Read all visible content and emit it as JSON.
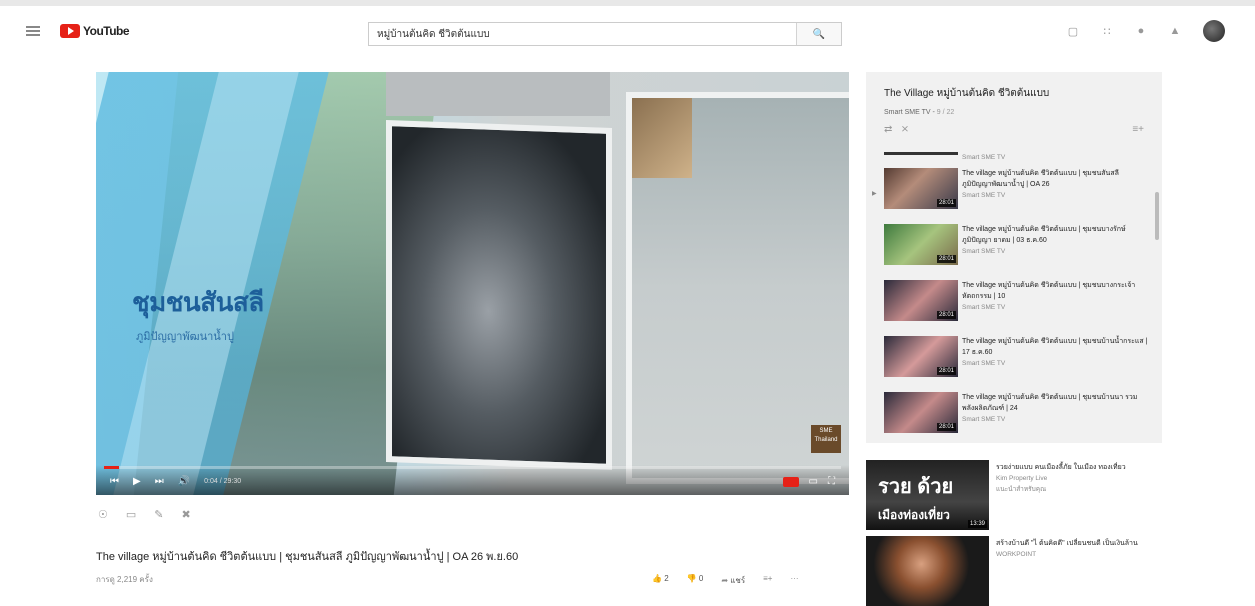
{
  "header": {
    "logo_text": "YouTube",
    "search_value": "หมู่บ้านต้นคิด ชีวิตต้นแบบ"
  },
  "player": {
    "overlay_title": "ชุมชนสันสลี",
    "overlay_subtitle": "ภูมิปัญญาพัฒนาน้ำปู",
    "time": "0:04 / 29:30",
    "progress": 0.02,
    "watermark": "SME Thailand"
  },
  "video": {
    "title": "The village หมู่บ้านต้นคิด ชีวิตต้นแบบ | ชุมชนสันสลี ภูมิปัญญาพัฒนาน้ำปู | OA 26 พ.ย.60",
    "views": "การดู 2,219 ครั้ง",
    "likes": "2",
    "dislikes": "0",
    "share": "แชร์"
  },
  "playlist": {
    "title": "The Village หมู่บ้านต้นคิด ชีวิตต้นแบบ",
    "channel": "Smart SME TV",
    "position": "9 / 22",
    "first_channel": "Smart SME TV",
    "items": [
      {
        "index": "▶",
        "title": "The village หมู่บ้านต้นคิด ชีวิตต้นแบบ | ชุมชนสันสลี ภูมิปัญญาพัฒนาน้ำปู | OA 26",
        "channel": "Smart SME TV",
        "duration": "28:01"
      },
      {
        "index": "",
        "title": "The village หมู่บ้านต้นคิด ชีวิตต้นแบบ | ชุมชนบางรักษ์ ภูมิปัญญา ยาดม | 03 ธ.ค.60",
        "channel": "Smart SME TV",
        "duration": "28:01"
      },
      {
        "index": "",
        "title": "The village หมู่บ้านต้นคิด ชีวิตต้นแบบ | ชุมชนบางกระเจ้า หัตถกรรม | 10",
        "channel": "Smart SME TV",
        "duration": "28:01"
      },
      {
        "index": "",
        "title": "The village หมู่บ้านต้นคิด ชีวิตต้นแบบ | ชุมชนบ้านน้ำกระแส | 17 ธ.ค.60",
        "channel": "Smart SME TV",
        "duration": "28:01"
      },
      {
        "index": "",
        "title": "The village หมู่บ้านต้นคิด ชีวิตต้นแบบ | ชุมชนบ้านนา รวมพลังผลิตภัณฑ์ | 24",
        "channel": "Smart SME TV",
        "duration": "28:01"
      }
    ]
  },
  "recommendations": [
    {
      "title": "รวยง่ายแบบ คนเมืองลี้ภัย ในเมือง ทองเที่ยว",
      "channel": "Kim Property Live",
      "meta": "แนะนำสำหรับคุณ",
      "thumb_text_1": "รวย ด้วย",
      "thumb_text_2": "เมืองท่องเที่ยว",
      "duration": "13:39"
    },
    {
      "title": "สร้างบ้านดี \"ไ ต้นคิดดี\" เปลี่ยนชนดี เป็นเงินล้าน",
      "channel": "WORKPOINT",
      "meta": "",
      "thumb_text_1": "",
      "thumb_text_2": "",
      "duration": ""
    }
  ]
}
